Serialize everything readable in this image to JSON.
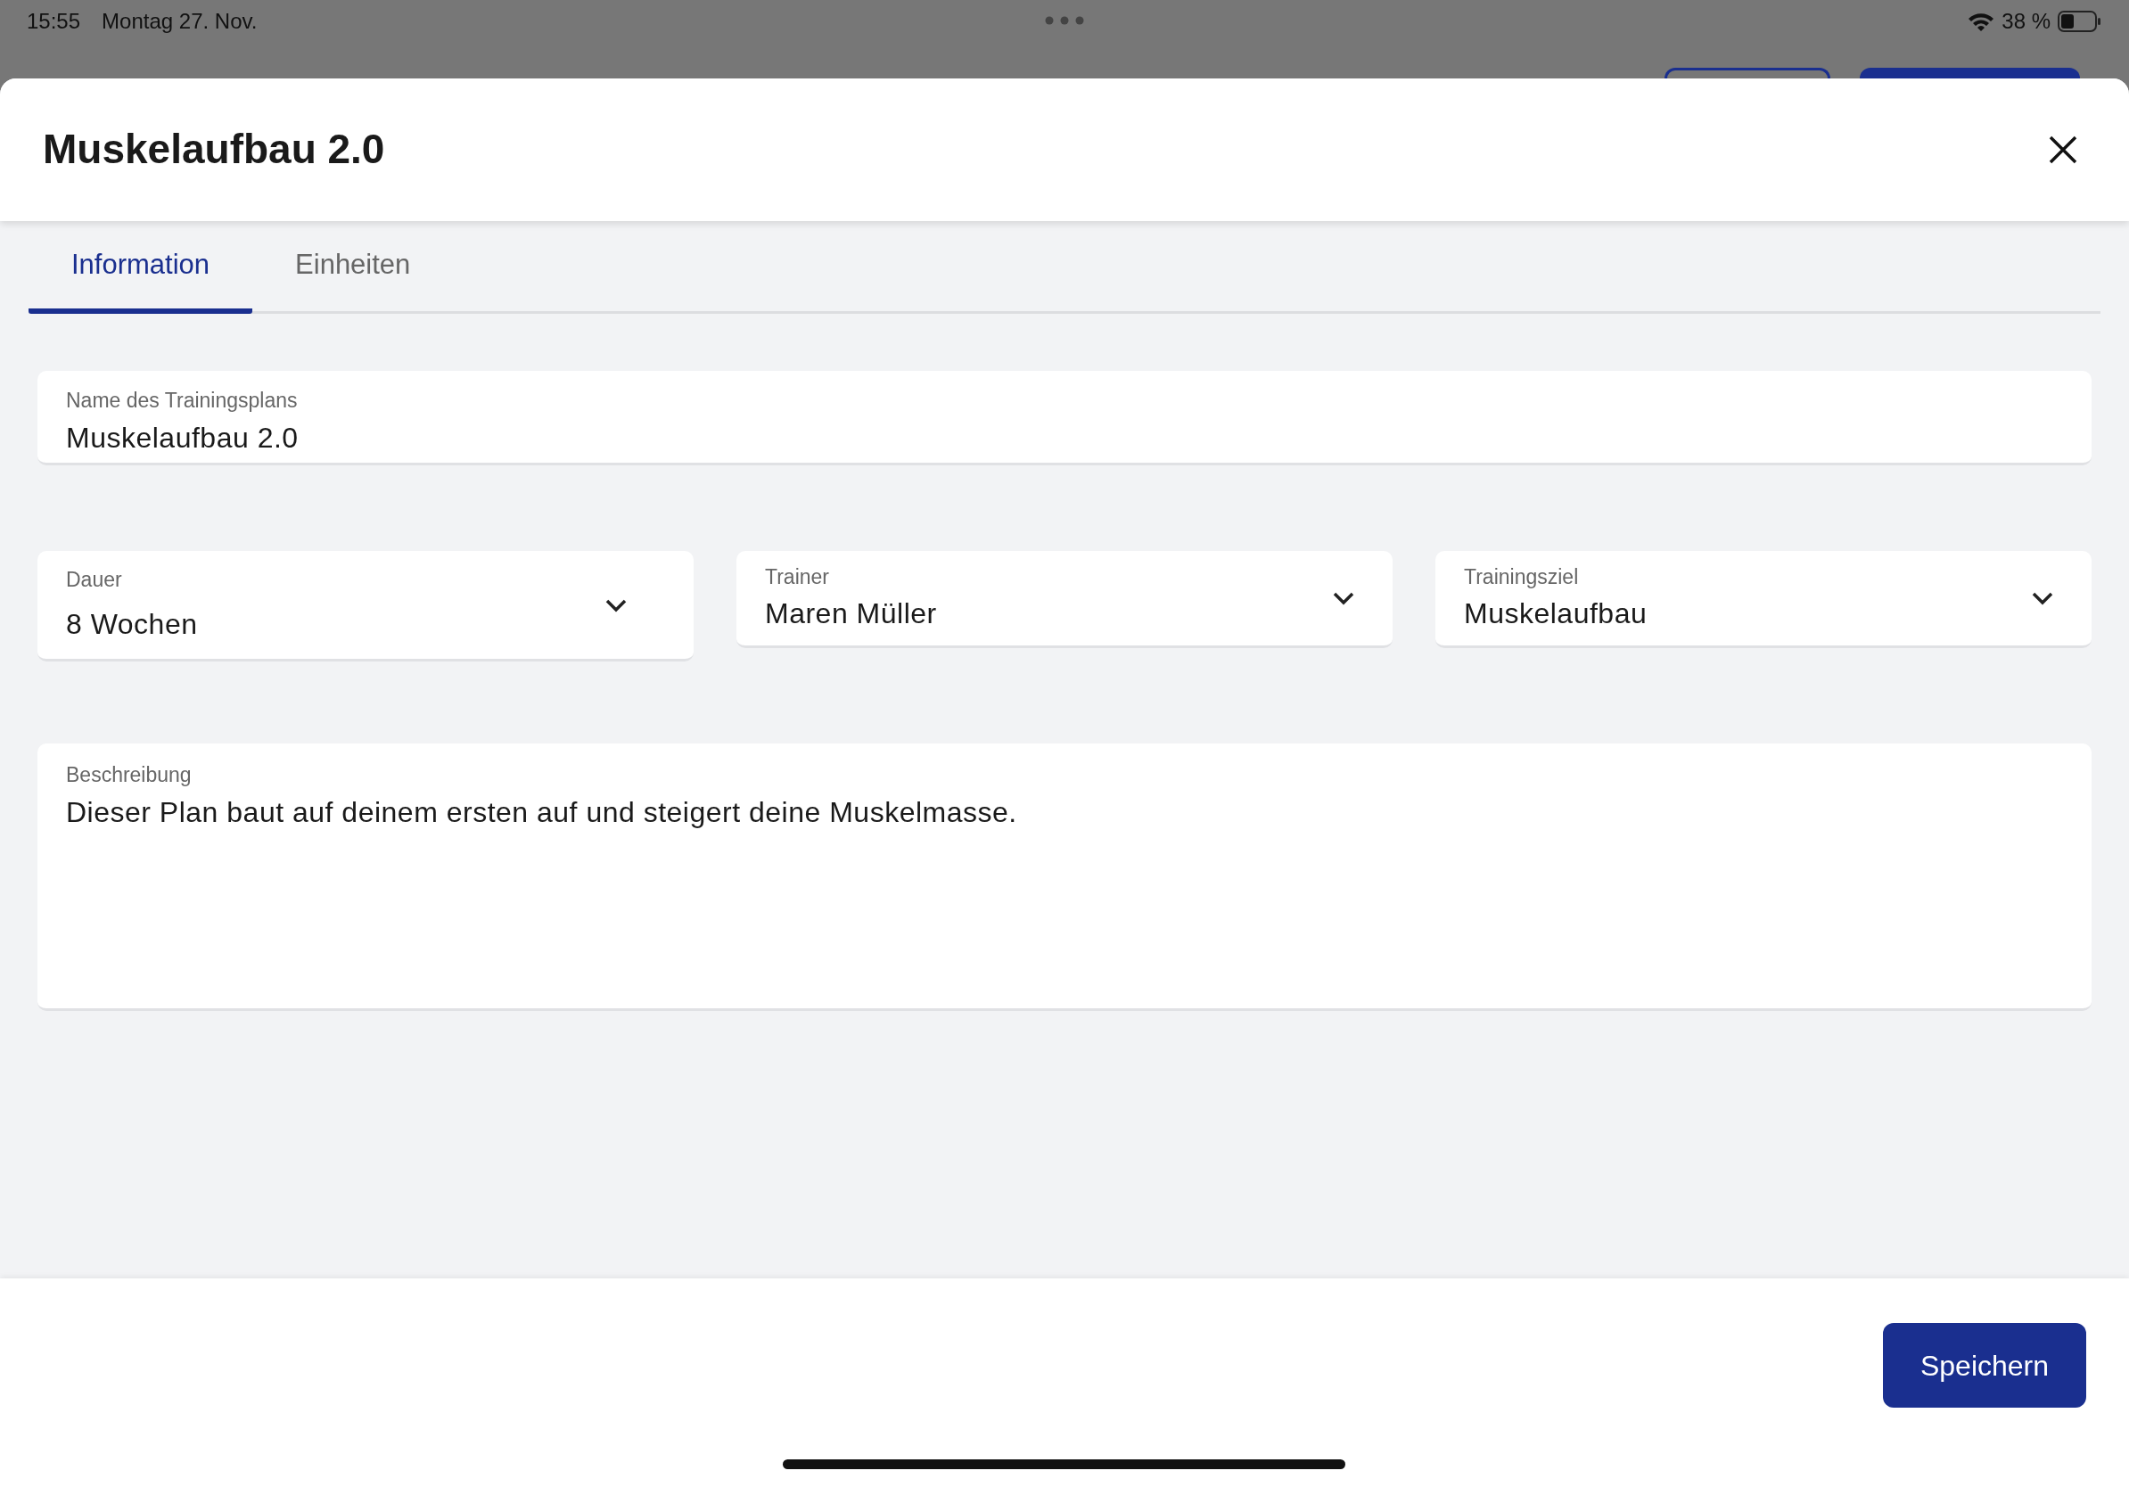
{
  "status_bar": {
    "time": "15:55",
    "date": "Montag 27. Nov.",
    "battery": "38 %"
  },
  "dialog": {
    "title": "Muskelaufbau 2.0"
  },
  "tabs": [
    {
      "label": "Information",
      "selected": true
    },
    {
      "label": "Einheiten",
      "selected": false
    }
  ],
  "name_field": {
    "label": "Name des Trainingsplans",
    "value": "Muskelaufbau 2.0"
  },
  "selects": [
    {
      "label": "Dauer",
      "value": "8 Wochen"
    },
    {
      "label": "Trainer",
      "value": "Maren Müller"
    },
    {
      "label": "Trainingsziel",
      "value": "Muskelaufbau"
    }
  ],
  "description": {
    "label": "Beschreibung",
    "value": "Dieser Plan baut auf deinem ersten auf und steigert deine Muskelmasse."
  },
  "footer": {
    "button": "Speichern"
  }
}
